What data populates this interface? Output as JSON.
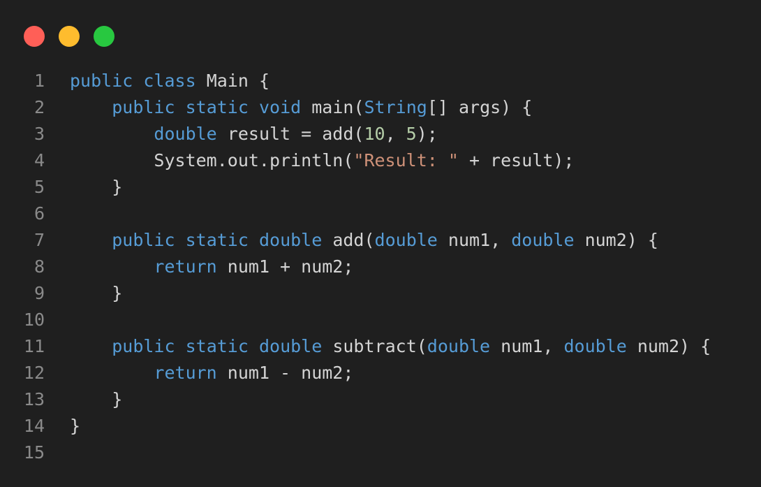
{
  "window": {
    "controls": [
      {
        "name": "close",
        "color": "#ff5f57"
      },
      {
        "name": "minimize",
        "color": "#febc2e"
      },
      {
        "name": "maximize",
        "color": "#28c840"
      }
    ]
  },
  "colors": {
    "background": "#1f1f1f",
    "keyword": "#569cd6",
    "type": "#4ec9b0",
    "string": "#ce9178",
    "number": "#b5cea8",
    "plain": "#d4d4d4",
    "line_number": "#8a8a8a"
  },
  "code": {
    "lines": [
      {
        "n": "1",
        "tokens": [
          {
            "t": "keyword",
            "v": "public"
          },
          {
            "t": "plain",
            "v": " "
          },
          {
            "t": "keyword",
            "v": "class"
          },
          {
            "t": "plain",
            "v": " Main {"
          }
        ]
      },
      {
        "n": "2",
        "tokens": [
          {
            "t": "plain",
            "v": "    "
          },
          {
            "t": "keyword",
            "v": "public"
          },
          {
            "t": "plain",
            "v": " "
          },
          {
            "t": "keyword",
            "v": "static"
          },
          {
            "t": "plain",
            "v": " "
          },
          {
            "t": "keyword",
            "v": "void"
          },
          {
            "t": "plain",
            "v": " main("
          },
          {
            "t": "keyword",
            "v": "String"
          },
          {
            "t": "plain",
            "v": "[] args) {"
          }
        ]
      },
      {
        "n": "3",
        "tokens": [
          {
            "t": "plain",
            "v": "        "
          },
          {
            "t": "keyword",
            "v": "double"
          },
          {
            "t": "plain",
            "v": " result = add("
          },
          {
            "t": "number",
            "v": "10"
          },
          {
            "t": "plain",
            "v": ", "
          },
          {
            "t": "number",
            "v": "5"
          },
          {
            "t": "plain",
            "v": ");"
          }
        ]
      },
      {
        "n": "4",
        "tokens": [
          {
            "t": "plain",
            "v": "        System.out.println("
          },
          {
            "t": "string",
            "v": "\"Result: \""
          },
          {
            "t": "plain",
            "v": " + result);"
          }
        ]
      },
      {
        "n": "5",
        "tokens": [
          {
            "t": "plain",
            "v": "    }"
          }
        ]
      },
      {
        "n": "6",
        "tokens": []
      },
      {
        "n": "7",
        "tokens": [
          {
            "t": "plain",
            "v": "    "
          },
          {
            "t": "keyword",
            "v": "public"
          },
          {
            "t": "plain",
            "v": " "
          },
          {
            "t": "keyword",
            "v": "static"
          },
          {
            "t": "plain",
            "v": " "
          },
          {
            "t": "keyword",
            "v": "double"
          },
          {
            "t": "plain",
            "v": " add("
          },
          {
            "t": "keyword",
            "v": "double"
          },
          {
            "t": "plain",
            "v": " num1, "
          },
          {
            "t": "keyword",
            "v": "double"
          },
          {
            "t": "plain",
            "v": " num2) {"
          }
        ]
      },
      {
        "n": "8",
        "tokens": [
          {
            "t": "plain",
            "v": "        "
          },
          {
            "t": "keyword",
            "v": "return"
          },
          {
            "t": "plain",
            "v": " num1 + num2;"
          }
        ]
      },
      {
        "n": "9",
        "tokens": [
          {
            "t": "plain",
            "v": "    }"
          }
        ]
      },
      {
        "n": "10",
        "tokens": []
      },
      {
        "n": "11",
        "tokens": [
          {
            "t": "plain",
            "v": "    "
          },
          {
            "t": "keyword",
            "v": "public"
          },
          {
            "t": "plain",
            "v": " "
          },
          {
            "t": "keyword",
            "v": "static"
          },
          {
            "t": "plain",
            "v": " "
          },
          {
            "t": "keyword",
            "v": "double"
          },
          {
            "t": "plain",
            "v": " subtract("
          },
          {
            "t": "keyword",
            "v": "double"
          },
          {
            "t": "plain",
            "v": " num1, "
          },
          {
            "t": "keyword",
            "v": "double"
          },
          {
            "t": "plain",
            "v": " num2) {"
          }
        ]
      },
      {
        "n": "12",
        "tokens": [
          {
            "t": "plain",
            "v": "        "
          },
          {
            "t": "keyword",
            "v": "return"
          },
          {
            "t": "plain",
            "v": " num1 - num2;"
          }
        ]
      },
      {
        "n": "13",
        "tokens": [
          {
            "t": "plain",
            "v": "    }"
          }
        ]
      },
      {
        "n": "14",
        "tokens": [
          {
            "t": "plain",
            "v": "}"
          }
        ]
      },
      {
        "n": "15",
        "tokens": []
      }
    ]
  }
}
